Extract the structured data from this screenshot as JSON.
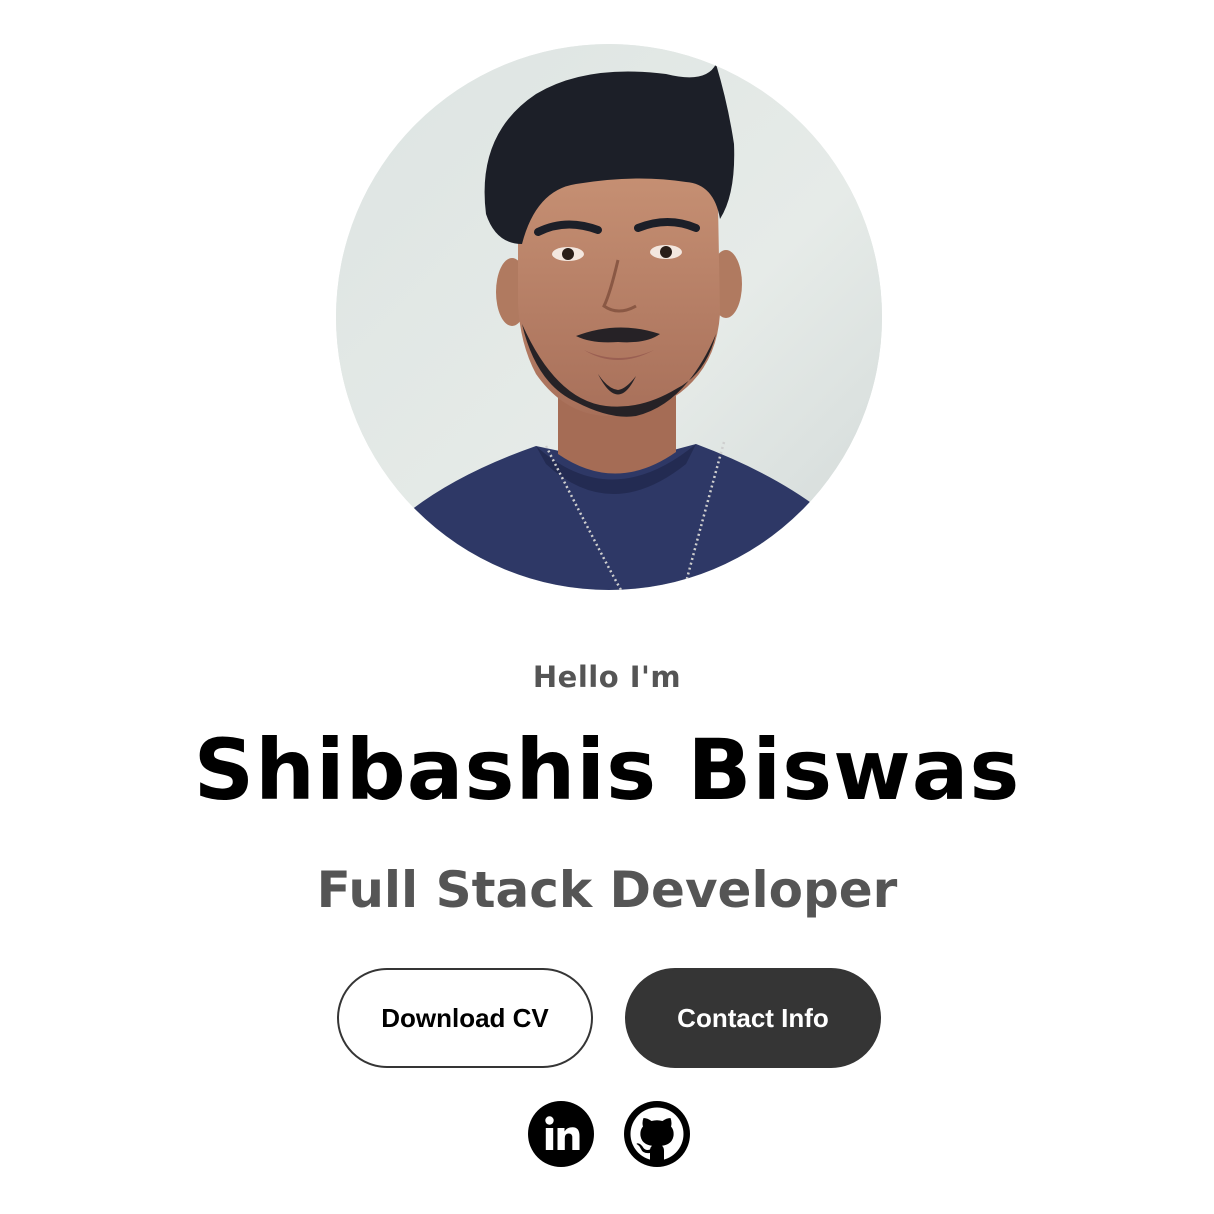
{
  "hero": {
    "greeting": "Hello I'm",
    "name": "Shibashis Biswas",
    "title": "Full Stack Developer"
  },
  "actions": {
    "download_cv_label": "Download CV",
    "contact_info_label": "Contact Info"
  },
  "social": [
    {
      "icon": "linkedin-icon",
      "label": "LinkedIn"
    },
    {
      "icon": "github-icon",
      "label": "GitHub"
    }
  ],
  "colors": {
    "primary_text": "#000000",
    "secondary_text": "#555555",
    "button_dark": "#353535",
    "background": "#ffffff"
  }
}
